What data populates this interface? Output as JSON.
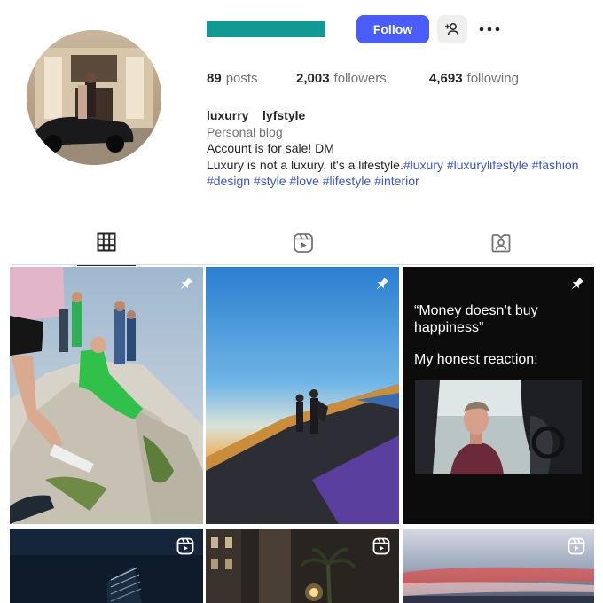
{
  "profile": {
    "username_bar_color": "#119a94",
    "follow_label": "Follow",
    "follow_color": "#4a5df9",
    "suggest_icon": "person-add-icon",
    "more_icon": "more-horizontal-icon"
  },
  "stats": {
    "posts_count": "89",
    "posts_label": "posts",
    "followers_count": "2,003",
    "followers_label": "followers",
    "following_count": "4,693",
    "following_label": "following"
  },
  "bio": {
    "handle": "luxurry__lyfstyle",
    "category": "Personal blog",
    "line1": "Account is for sale! DM",
    "line2_text": "Luxury is not a luxury, it's a lifestyle.",
    "line2_tags": "#luxury #luxurylifestyle #fashion",
    "line3_tags": "#design #style #love #lifestyle #interior",
    "tag_color": "#3d55c8"
  },
  "tabs": [
    {
      "icon": "grid-icon",
      "active": true
    },
    {
      "icon": "reels-icon",
      "active": false
    },
    {
      "icon": "tagged-icon",
      "active": false
    }
  ],
  "posts": [
    {
      "badge": "pin-icon"
    },
    {
      "badge": "pin-icon"
    },
    {
      "badge": "pin-icon",
      "quote": "“Money doesn’t buy happiness”",
      "reaction": "My honest reaction:"
    },
    {
      "badge": "reel-icon"
    },
    {
      "badge": "reel-icon"
    },
    {
      "badge": "reel-icon"
    }
  ]
}
